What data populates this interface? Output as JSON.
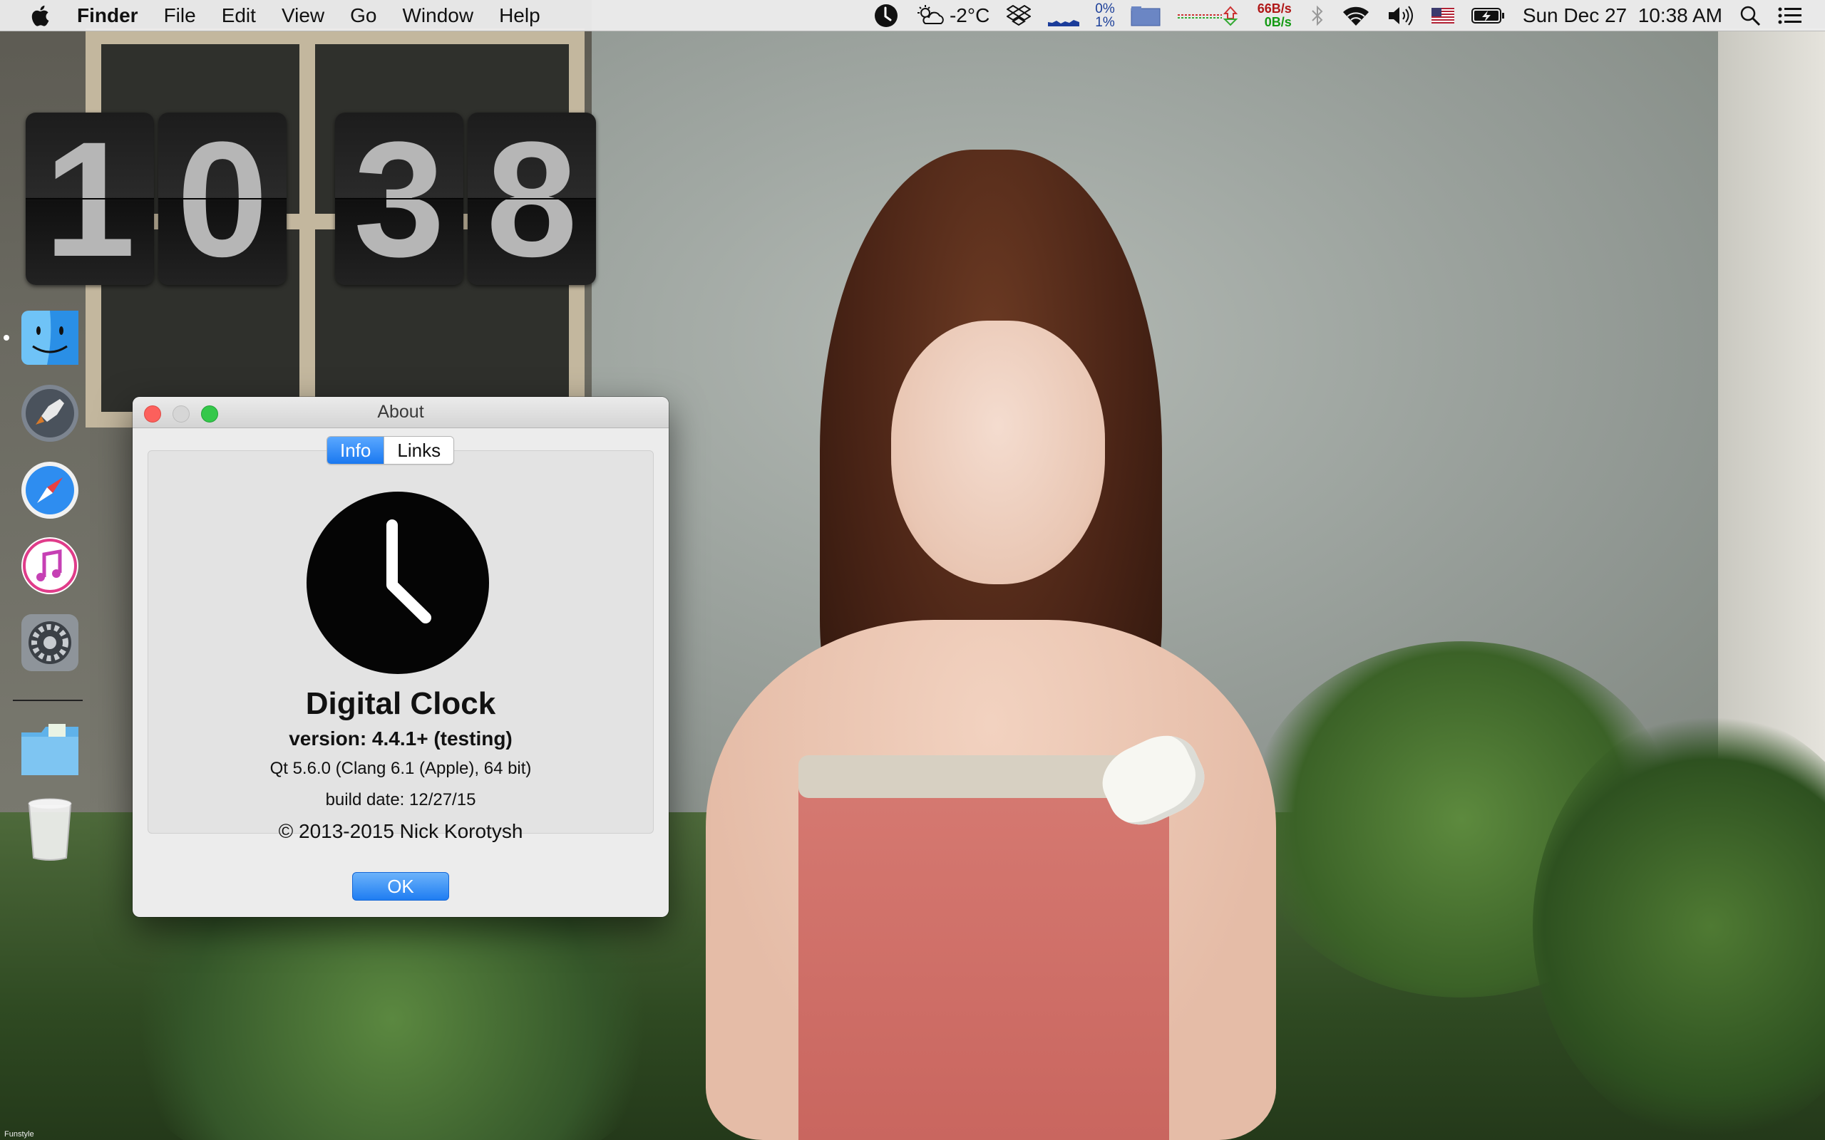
{
  "menubar": {
    "app_name": "Finder",
    "menus": [
      "File",
      "Edit",
      "View",
      "Go",
      "Window",
      "Help"
    ],
    "weather": "-2°C",
    "cpu_top": "0%",
    "cpu_bottom": "1%",
    "net_up": "66B/s",
    "net_down": "0B/s",
    "datetime": "Sun Dec 27  10:38 AM",
    "net_up_color": "#b01818",
    "net_down_color": "#149a14"
  },
  "flip_clock": {
    "digits": [
      "1",
      "0",
      "3",
      "8"
    ]
  },
  "dock": {
    "apps": [
      "finder-icon",
      "launchpad-icon",
      "safari-icon",
      "itunes-icon",
      "system-preferences-icon",
      "downloads-folder-icon",
      "trash-icon"
    ]
  },
  "watermark": "Funstyle",
  "about_window": {
    "title": "About",
    "tabs": [
      {
        "label": "Info",
        "active": true
      },
      {
        "label": "Links",
        "active": false
      }
    ],
    "app_name": "Digital Clock",
    "version": "version: 4.4.1+ (testing)",
    "qt_info": "Qt 5.6.0 (Clang 6.1 (Apple), 64 bit)",
    "build_date": "build date: 12/27/15",
    "copyright": "© 2013-2015 Nick Korotysh",
    "ok_label": "OK",
    "accent_color": "#1a78f0"
  }
}
